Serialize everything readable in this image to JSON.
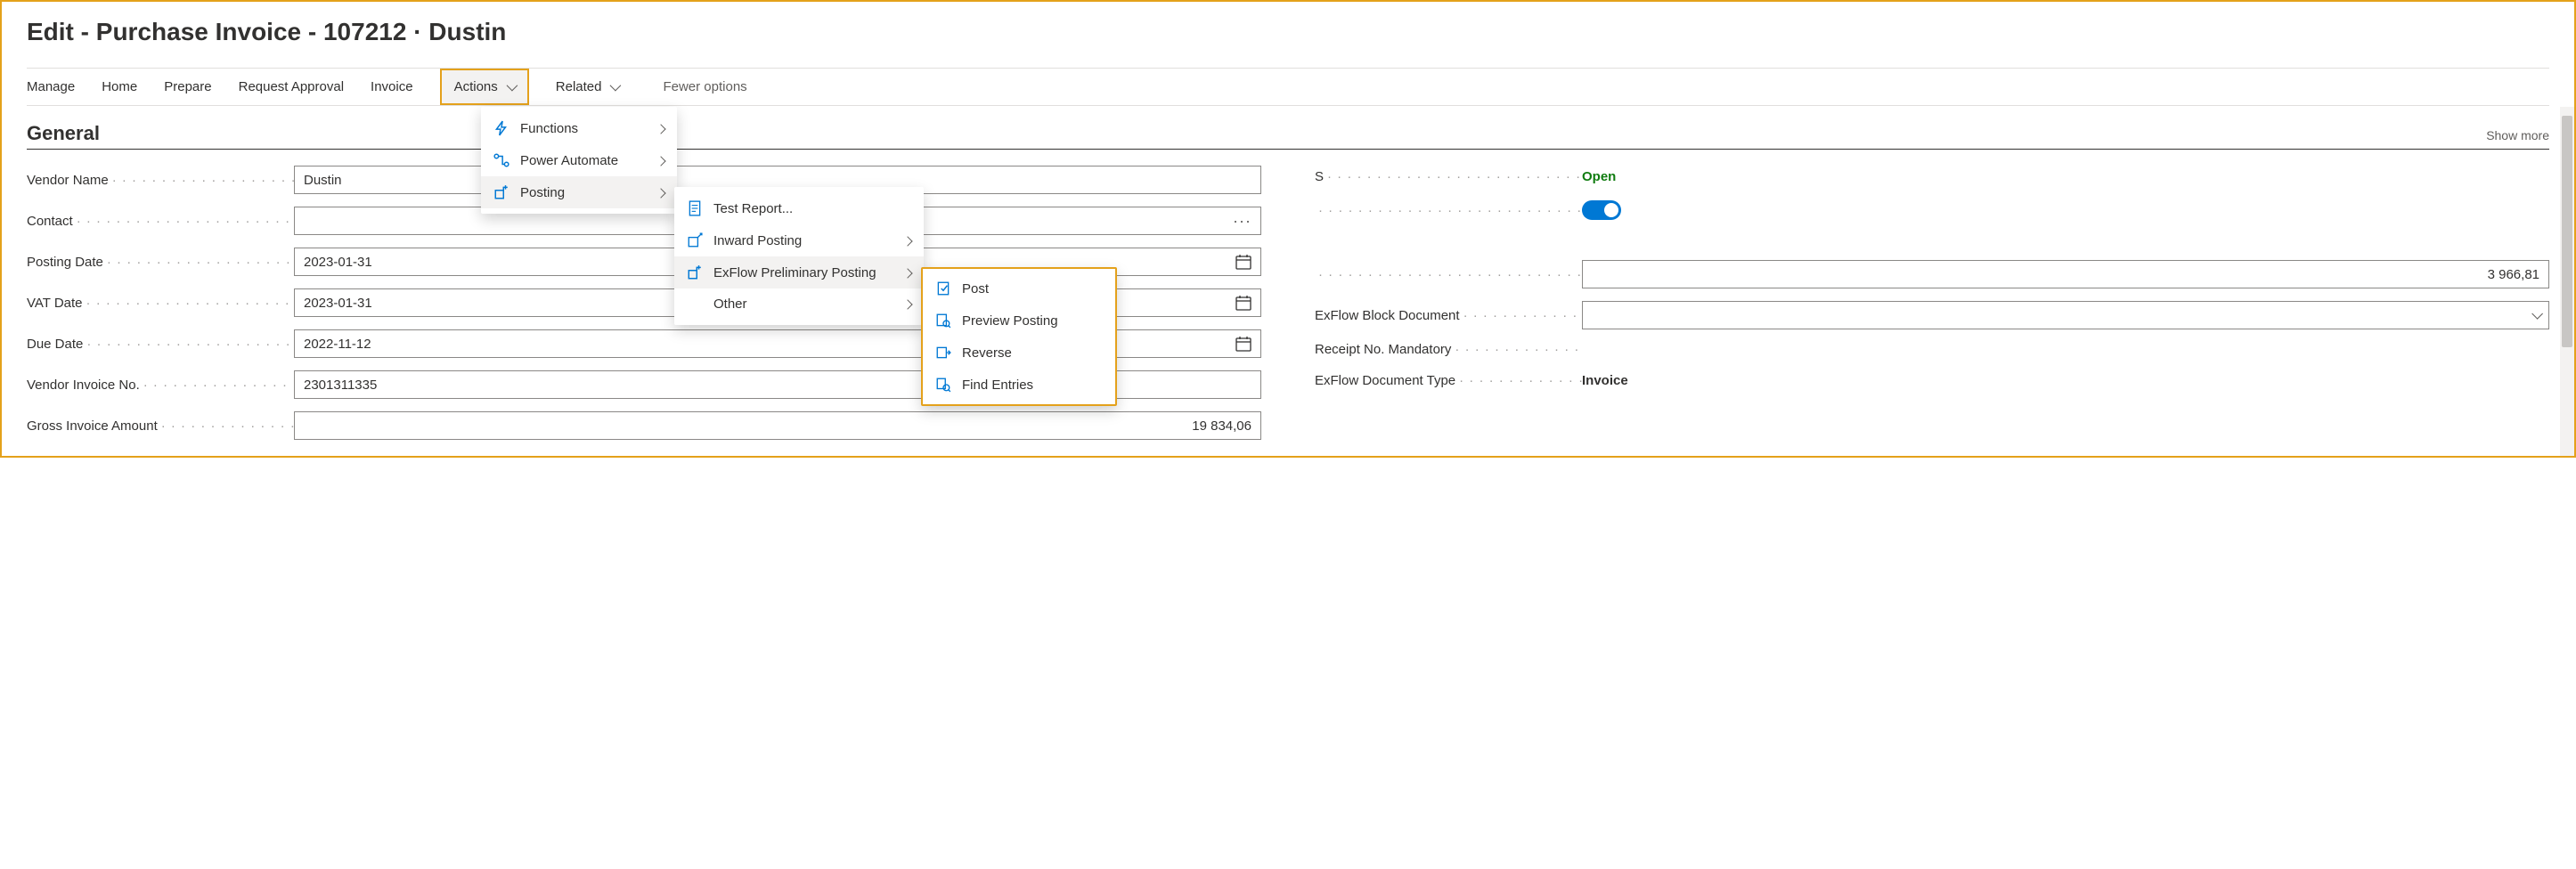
{
  "page_title": "Edit - Purchase Invoice - 107212 · Dustin",
  "toolbar": {
    "manage": "Manage",
    "home": "Home",
    "prepare": "Prepare",
    "request_approval": "Request Approval",
    "invoice": "Invoice",
    "actions": "Actions",
    "related": "Related",
    "fewer_options": "Fewer options"
  },
  "section": {
    "general": "General",
    "show_more": "Show more"
  },
  "fields": {
    "vendor_name": {
      "label": "Vendor Name",
      "value": "Dustin"
    },
    "contact": {
      "label": "Contact",
      "value": ""
    },
    "posting_date": {
      "label": "Posting Date",
      "value": "2023-01-31"
    },
    "vat_date": {
      "label": "VAT Date",
      "value": "2023-01-31"
    },
    "due_date": {
      "label": "Due Date",
      "value": "2022-11-12"
    },
    "vendor_invoice_no": {
      "label": "Vendor Invoice No.",
      "value": "2301311335"
    },
    "gross_invoice_amount": {
      "label": "Gross Invoice Amount",
      "value": "19 834,06"
    },
    "status": {
      "label": "Status",
      "value": "Open"
    },
    "amount_value": {
      "value": "3 966,81"
    },
    "exflow_block_document": {
      "label": "ExFlow Block Document",
      "value": ""
    },
    "receipt_no_mandatory": {
      "label": "Receipt No. Mandatory",
      "value": ""
    },
    "exflow_document_type": {
      "label": "ExFlow Document Type",
      "value": "Invoice"
    }
  },
  "menu1": {
    "functions": "Functions",
    "power_automate": "Power Automate",
    "posting": "Posting"
  },
  "menu2": {
    "test_report": "Test Report...",
    "inward_posting": "Inward Posting",
    "exflow_preliminary_posting": "ExFlow Preliminary Posting",
    "other": "Other"
  },
  "menu3": {
    "post": "Post",
    "preview_posting": "Preview Posting",
    "reverse": "Reverse",
    "find_entries": "Find Entries"
  }
}
